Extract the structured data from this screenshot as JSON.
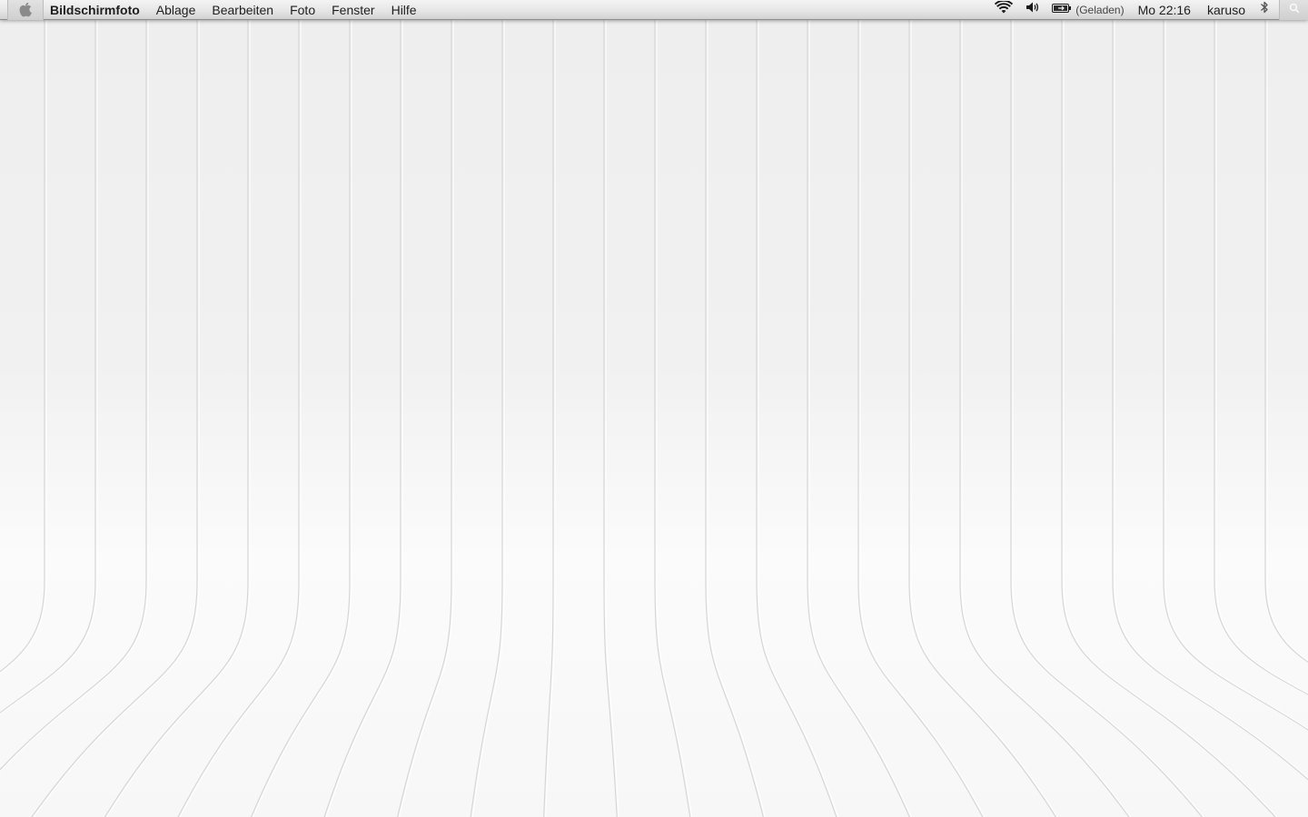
{
  "menubar": {
    "apple_icon": "apple-logo-icon",
    "app_name": "Bildschirmfoto",
    "menus": [
      {
        "label": "Ablage"
      },
      {
        "label": "Bearbeiten"
      },
      {
        "label": "Foto"
      },
      {
        "label": "Fenster"
      },
      {
        "label": "Hilfe"
      }
    ],
    "status": {
      "wifi_icon": "wifi-icon",
      "volume_icon": "volume-icon",
      "battery_icon": "battery-icon",
      "battery_state": "(Geladen)",
      "clock": "Mo 22:16",
      "user": "karuso",
      "bluetooth_icon": "bluetooth-icon",
      "spotlight_icon": "spotlight-search-icon"
    }
  },
  "desktop": {
    "wallpaper": "curved-stripes-wallpaper",
    "background_color": "#f1f1f1",
    "stripe_color": "#d6d6d6"
  }
}
